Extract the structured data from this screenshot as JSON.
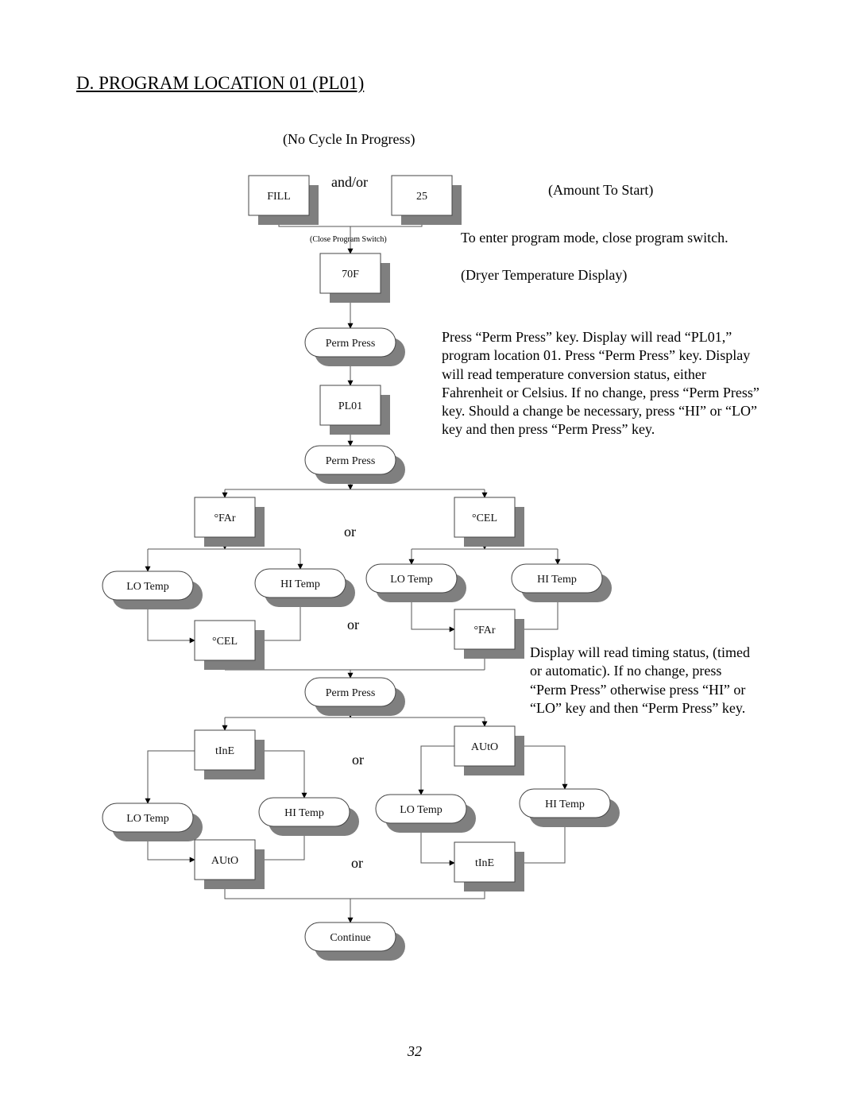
{
  "page": {
    "title": "D.  PROGRAM LOCATION 01 (PL01)",
    "page_number": "32"
  },
  "annotations": {
    "no_cycle": "(No Cycle In Progress)",
    "and_or": "and/or",
    "amount_to_start": "(Amount To Start)",
    "close_switch_small": "(Close Program Switch)",
    "enter_program_mode": "To enter program mode, close program switch.",
    "dryer_temp_display": "(Dryer Temperature Display)",
    "or_1": "or",
    "or_2": "or",
    "or_3": "or",
    "or_4": "or"
  },
  "paragraphs": {
    "temp_conversion": "Press “Perm Press” key.  Display will read “PL01,” program location 01.  Press “Perm Press” key.  Display will read temperature conversion status, either Fahrenheit or Celsius.  If no change, press “Perm Press” key.  Should a change be necessary, press “HI” or “LO” key and then press “Perm  Press” key.",
    "timing_status": "Display will read timing status, (timed or automatic).  If no change, press “Perm Press” otherwise press “HI” or “LO” key and then “Perm Press”  key."
  },
  "flowchart": {
    "nodes": [
      {
        "id": "fill",
        "shape": "display",
        "label": "FILL"
      },
      {
        "id": "amount",
        "shape": "display",
        "label": "25"
      },
      {
        "id": "temp70",
        "shape": "display",
        "label": "70F"
      },
      {
        "id": "pp1",
        "shape": "key",
        "label": "Perm Press"
      },
      {
        "id": "pl01",
        "shape": "display",
        "label": "PL01"
      },
      {
        "id": "pp2",
        "shape": "key",
        "label": "Perm Press"
      },
      {
        "id": "far1",
        "shape": "display",
        "label": "°FAr"
      },
      {
        "id": "cel1",
        "shape": "display",
        "label": "°CEL"
      },
      {
        "id": "lo1",
        "shape": "key",
        "label": "LO Temp"
      },
      {
        "id": "hi1",
        "shape": "key",
        "label": "HI Temp"
      },
      {
        "id": "lo2",
        "shape": "key",
        "label": "LO Temp"
      },
      {
        "id": "hi2",
        "shape": "key",
        "label": "HI Temp"
      },
      {
        "id": "cel2",
        "shape": "display",
        "label": "°CEL"
      },
      {
        "id": "far2",
        "shape": "display",
        "label": "°FAr"
      },
      {
        "id": "pp3",
        "shape": "key",
        "label": "Perm Press"
      },
      {
        "id": "time1",
        "shape": "display",
        "label": "tInE"
      },
      {
        "id": "auto1",
        "shape": "display",
        "label": "AUtO"
      },
      {
        "id": "lo3",
        "shape": "key",
        "label": "LO Temp"
      },
      {
        "id": "hi3",
        "shape": "key",
        "label": "HI Temp"
      },
      {
        "id": "lo4",
        "shape": "key",
        "label": "LO Temp"
      },
      {
        "id": "hi4",
        "shape": "key",
        "label": "HI Temp"
      },
      {
        "id": "auto2",
        "shape": "display",
        "label": "AUtO"
      },
      {
        "id": "time2",
        "shape": "display",
        "label": "tInE"
      },
      {
        "id": "cont",
        "shape": "key",
        "label": "Continue"
      }
    ]
  }
}
